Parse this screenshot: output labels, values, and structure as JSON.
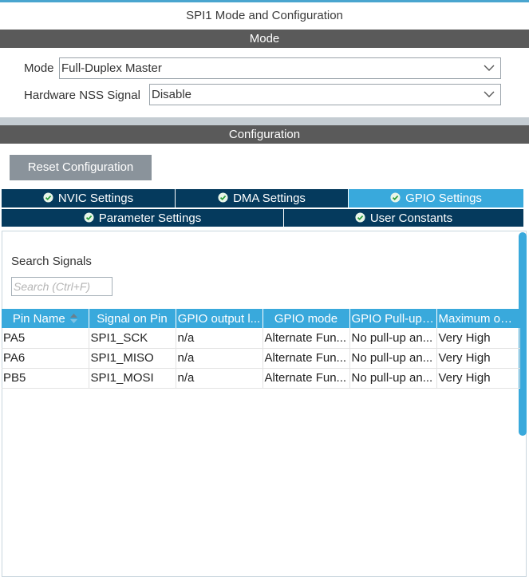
{
  "window": {
    "title": "SPI1 Mode and Configuration"
  },
  "mode_section": {
    "header": "Mode",
    "mode_label": "Mode",
    "mode_value": "Full-Duplex Master",
    "nss_label": "Hardware NSS Signal",
    "nss_value": "Disable"
  },
  "config_section": {
    "header": "Configuration",
    "reset_button": "Reset Configuration",
    "tabs": [
      {
        "label": "NVIC Settings",
        "active": false
      },
      {
        "label": "DMA Settings",
        "active": false
      },
      {
        "label": "GPIO Settings",
        "active": true
      },
      {
        "label": "Parameter Settings",
        "active": false
      },
      {
        "label": "User Constants",
        "active": false
      }
    ]
  },
  "signals": {
    "search_label": "Search Signals",
    "search_placeholder": "Search (Ctrl+F)",
    "columns": [
      "Pin Name",
      "Signal on Pin",
      "GPIO output l...",
      "GPIO mode",
      "GPIO Pull-up/...",
      "Maximum out..."
    ],
    "rows": [
      [
        "PA5",
        "SPI1_SCK",
        "n/a",
        "Alternate Fun...",
        "No pull-up an...",
        "Very High"
      ],
      [
        "PA6",
        "SPI1_MISO",
        "n/a",
        "Alternate Fun...",
        "No pull-up an...",
        "Very High"
      ],
      [
        "PB5",
        "SPI1_MOSI",
        "n/a",
        "Alternate Fun...",
        "No pull-up an...",
        "Very High"
      ]
    ]
  },
  "icons": {
    "tab_status": "check-circle-icon",
    "dropdown": "chevron-down-icon",
    "sort": "sort-icon"
  },
  "colors": {
    "accent": "#39a9dc",
    "tab_dark": "#053a5d",
    "section_bar": "#5a5a5a",
    "button": "#8a939b"
  }
}
